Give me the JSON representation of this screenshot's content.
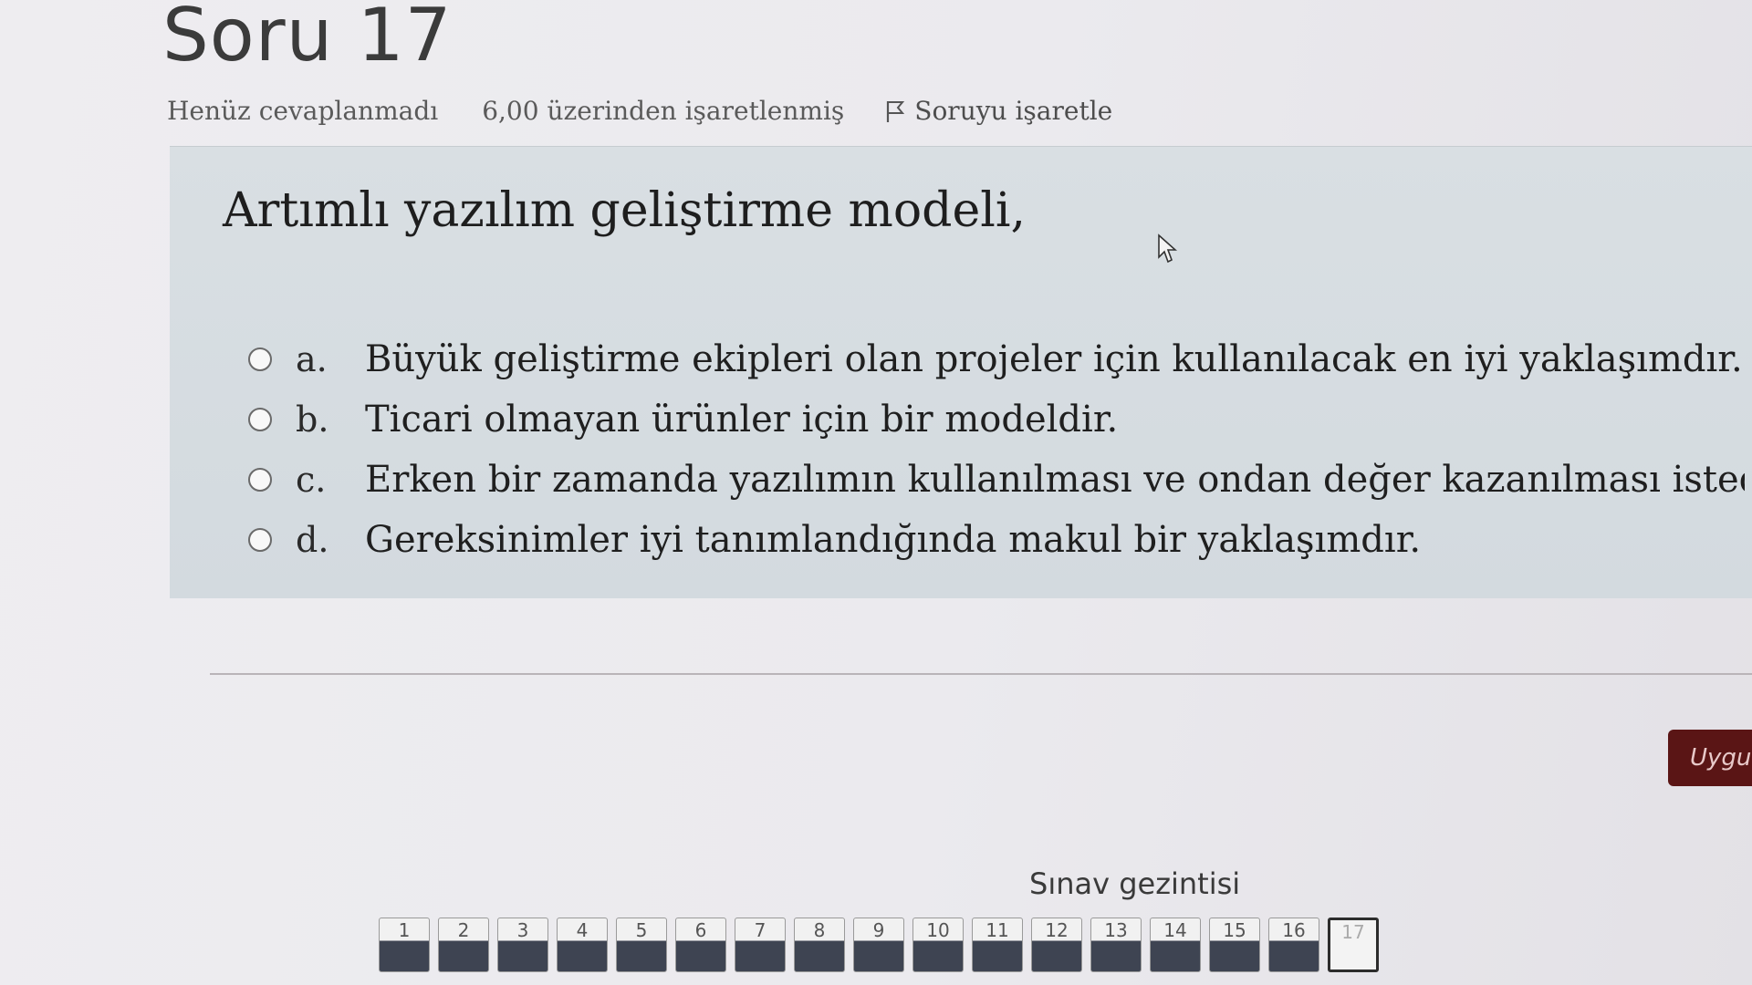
{
  "question": {
    "title": "Soru 17",
    "status": "Henüz cevaplanmadı",
    "marks": "6,00 üzerinden işaretlenmiş",
    "flag_label": "Soruyu işaretle",
    "text": "Artımlı yazılım geliştirme modeli,"
  },
  "answers": [
    {
      "letter": "a.",
      "text": "Büyük geliştirme ekipleri olan projeler için kullanılacak en iyi yaklaşımdır."
    },
    {
      "letter": "b.",
      "text": "Ticari olmayan ürünler için bir modeldir."
    },
    {
      "letter": "c.",
      "text": "Erken bir zamanda yazılımın kullanılması ve ondan değer kazanılması istediğinde iyi bir yaklaşı"
    },
    {
      "letter": "d.",
      "text": "Gereksinimler iyi tanımlandığında makul bir yaklaşımdır."
    }
  ],
  "apply_button": "Uygul",
  "navigation": {
    "title": "Sınav gezintisi",
    "pages": [
      "1",
      "2",
      "3",
      "4",
      "5",
      "6",
      "7",
      "8",
      "9",
      "10",
      "11",
      "12",
      "13",
      "14",
      "15",
      "16",
      "17"
    ],
    "current": "17"
  },
  "colors": {
    "question_box": "#d6dce0",
    "apply_button": "#5a1515",
    "nav_answered": "#3e4452"
  },
  "icons": {
    "flag": "flag-icon",
    "cursor": "mouse-pointer-icon"
  }
}
